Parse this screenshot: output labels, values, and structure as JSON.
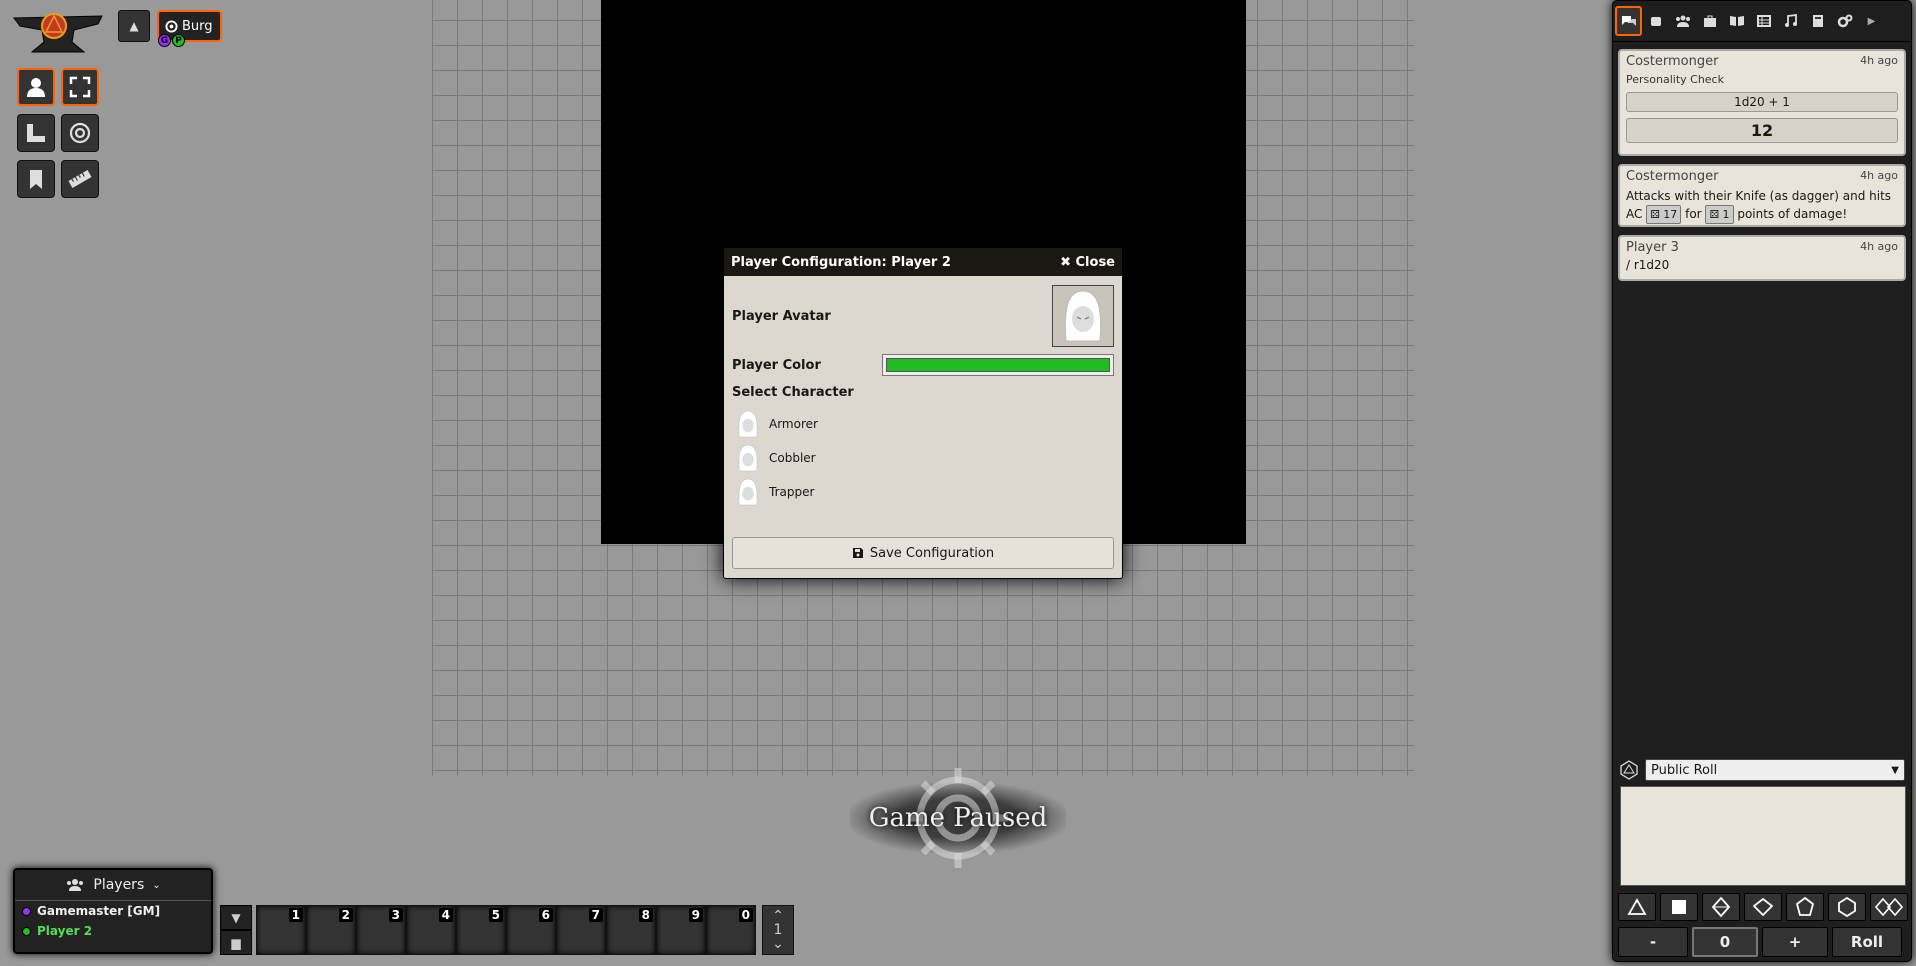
{
  "scene": {
    "nav_label": "Burg",
    "badges": [
      {
        "letter": "G",
        "color": "#9b30ff"
      },
      {
        "letter": "P",
        "color": "#22bb22"
      }
    ]
  },
  "colors": {
    "accent": "#ff6400",
    "player_color": "#22bb22",
    "gm_color": "#9b30ff"
  },
  "players": {
    "title": "Players",
    "list": [
      {
        "name": "Gamemaster [GM]",
        "color": "#9b30ff"
      },
      {
        "name": "Player 2",
        "color": "#22bb22"
      }
    ]
  },
  "hotbar": {
    "slots": [
      "1",
      "2",
      "3",
      "4",
      "5",
      "6",
      "7",
      "8",
      "9",
      "0"
    ],
    "page": "1"
  },
  "pause": {
    "label": "Game Paused"
  },
  "dialog": {
    "title": "Player Configuration: Player 2",
    "close_label": "Close",
    "avatar_label": "Player Avatar",
    "color_label": "Player Color",
    "select_label": "Select Character",
    "characters": [
      "Armorer",
      "Cobbler",
      "Trapper"
    ],
    "save_label": "Save Configuration"
  },
  "sidebar": {
    "tabs": [
      "chat-icon",
      "dice-icon",
      "users-icon",
      "suitcase-icon",
      "book-icon",
      "table-icon",
      "music-icon",
      "journal-icon",
      "cog-icon",
      "arrow-icon"
    ],
    "messages": [
      {
        "speaker": "Costermonger",
        "time": "4h ago",
        "flavor": "Personality Check",
        "formula": "1d20 + 1",
        "total": "12"
      },
      {
        "speaker": "Costermonger",
        "time": "4h ago",
        "text_pre": "Attacks with their Knife (as dagger) and hits AC",
        "ac": "17",
        "text_mid": "for",
        "dmg": "1",
        "text_post": "points of damage!"
      },
      {
        "speaker": "Player 3",
        "time": "4h ago",
        "text": "/ r1d20"
      }
    ],
    "roll_mode": "Public Roll",
    "modifier": "0",
    "minus_label": "-",
    "plus_label": "+",
    "roll_label": "Roll"
  }
}
